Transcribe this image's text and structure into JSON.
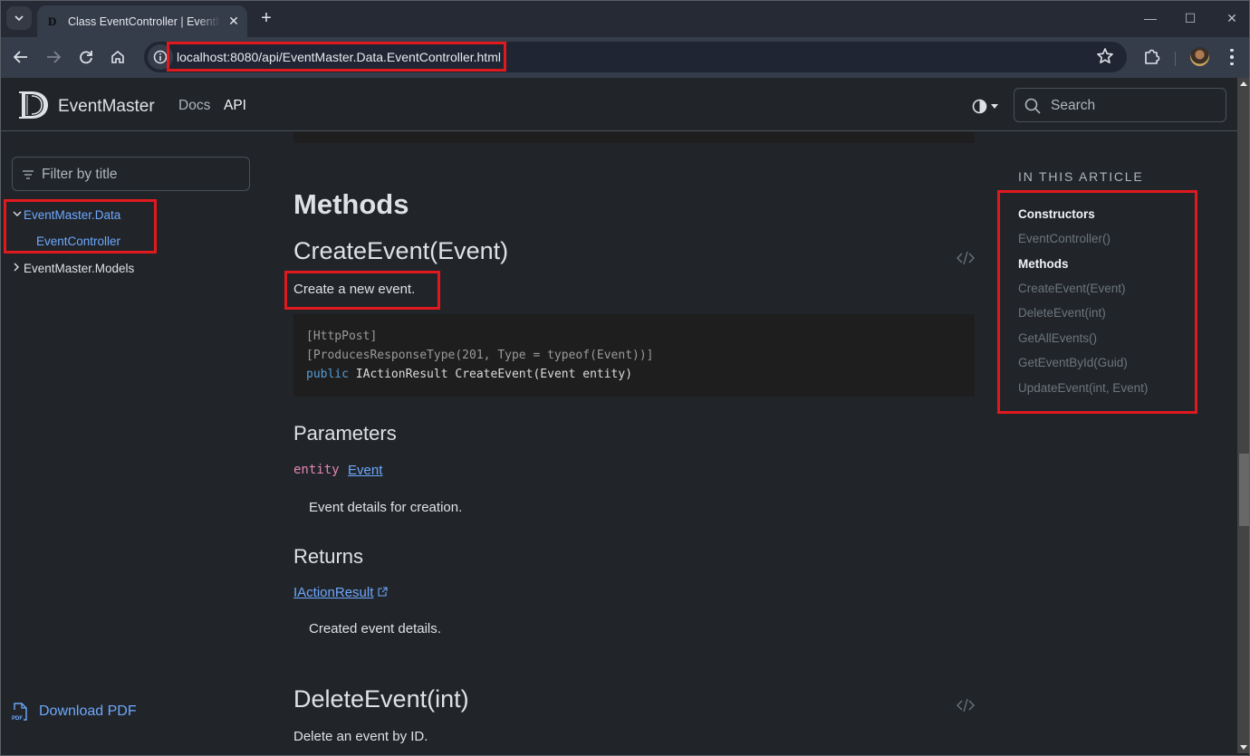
{
  "browser": {
    "tab_title": "Class EventController | EventMaster",
    "tab_favicon": "D",
    "new_tab_label": "+",
    "url": "localhost:8080/api/EventMaster.Data.EventController.html",
    "window_controls": {
      "minimize": "—",
      "maximize": "☐",
      "close": "✕"
    }
  },
  "header": {
    "brand": "EventMaster",
    "logo_letter": "D",
    "nav": [
      {
        "label": "Docs",
        "active": false
      },
      {
        "label": "API",
        "active": true
      }
    ],
    "search_placeholder": "Search"
  },
  "sidebar": {
    "filter_placeholder": "Filter by title",
    "tree": [
      {
        "label": "EventMaster.Data",
        "expanded": true,
        "children": [
          {
            "label": "EventController",
            "active": true
          }
        ]
      },
      {
        "label": "EventMaster.Models",
        "expanded": false
      }
    ],
    "download_pdf": "Download PDF",
    "pdf_icon_text": "PDF"
  },
  "article": {
    "section_heading": "Methods",
    "methods": [
      {
        "name": "CreateEvent(Event)",
        "summary": "Create a new event.",
        "code": {
          "line1": "[HttpPost]",
          "line2": "[ProducesResponseType(201, Type = typeof(Event))]",
          "line3_keyword": "public",
          "line3_rest": " IActionResult CreateEvent(Event entity)"
        },
        "parameters_heading": "Parameters",
        "parameter": {
          "name": "entity",
          "type": "Event",
          "description": "Event details for creation."
        },
        "returns_heading": "Returns",
        "returns": {
          "type": "IActionResult",
          "description": "Created event details."
        }
      },
      {
        "name": "DeleteEvent(int)",
        "summary": "Delete an event by ID."
      }
    ]
  },
  "in_this_article": {
    "title": "IN THIS ARTICLE",
    "items": [
      {
        "label": "Constructors",
        "kind": "section"
      },
      {
        "label": "EventController()",
        "kind": "link"
      },
      {
        "label": "Methods",
        "kind": "section"
      },
      {
        "label": "CreateEvent(Event)",
        "kind": "link"
      },
      {
        "label": "DeleteEvent(int)",
        "kind": "link"
      },
      {
        "label": "GetAllEvents()",
        "kind": "link"
      },
      {
        "label": "GetEventById(Guid)",
        "kind": "link"
      },
      {
        "label": "UpdateEvent(int, Event)",
        "kind": "link"
      }
    ]
  },
  "colors": {
    "background": "#212529",
    "link": "#6ea8fe",
    "highlight_box": "#e0191e",
    "param_name": "#e685b5",
    "code_keyword": "#569cd6"
  }
}
